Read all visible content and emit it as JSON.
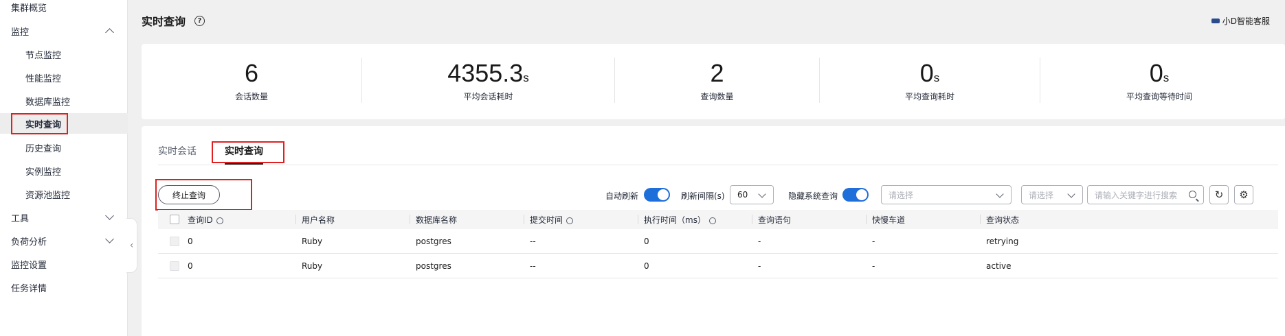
{
  "sidebar": {
    "items": [
      {
        "label": "集群概览"
      },
      {
        "label": "监控"
      },
      {
        "label": "节点监控"
      },
      {
        "label": "性能监控"
      },
      {
        "label": "数据库监控"
      },
      {
        "label": "实时查询"
      },
      {
        "label": "历史查询"
      },
      {
        "label": "实例监控"
      },
      {
        "label": "资源池监控"
      },
      {
        "label": "工具"
      },
      {
        "label": "负荷分析"
      },
      {
        "label": "监控设置"
      },
      {
        "label": "任务详情"
      }
    ],
    "collapse_glyph": "‹"
  },
  "header": {
    "title": "实时查询",
    "help_glyph": "?",
    "assistant_label": "小D智能客服"
  },
  "stats": [
    {
      "value": "6",
      "unit": "",
      "label": "会话数量"
    },
    {
      "value": "4355.3",
      "unit": "s",
      "label": "平均会话耗时"
    },
    {
      "value": "2",
      "unit": "",
      "label": "查询数量"
    },
    {
      "value": "0",
      "unit": "s",
      "label": "平均查询耗时"
    },
    {
      "value": "0",
      "unit": "s",
      "label": "平均查询等待时间"
    }
  ],
  "tabs": [
    {
      "label": "实时会话"
    },
    {
      "label": "实时查询"
    }
  ],
  "toolbar": {
    "stop_label": "终止查询",
    "auto_refresh_label": "自动刷新",
    "refresh_interval_label": "刷新间隔(s)",
    "refresh_interval_value": "60",
    "hide_system_label": "隐藏系统查询",
    "select1_placeholder": "请选择",
    "select2_placeholder": "请选择",
    "search_placeholder": "请输入关键字进行搜索",
    "refresh_glyph": "↻",
    "settings_glyph": "⚙"
  },
  "table": {
    "columns": [
      "查询ID",
      "用户名称",
      "数据库名称",
      "提交时间",
      "执行时间（ms）",
      "查询语句",
      "快慢车道",
      "查询状态"
    ],
    "rows": [
      [
        "0",
        "Ruby",
        "postgres",
        "--",
        "0",
        "-",
        "-",
        "retrying"
      ],
      [
        "0",
        "Ruby",
        "postgres",
        "--",
        "0",
        "-",
        "-",
        "active"
      ]
    ]
  },
  "colors": {
    "accent": "#1e6fd9",
    "highlight": "#e02020"
  }
}
